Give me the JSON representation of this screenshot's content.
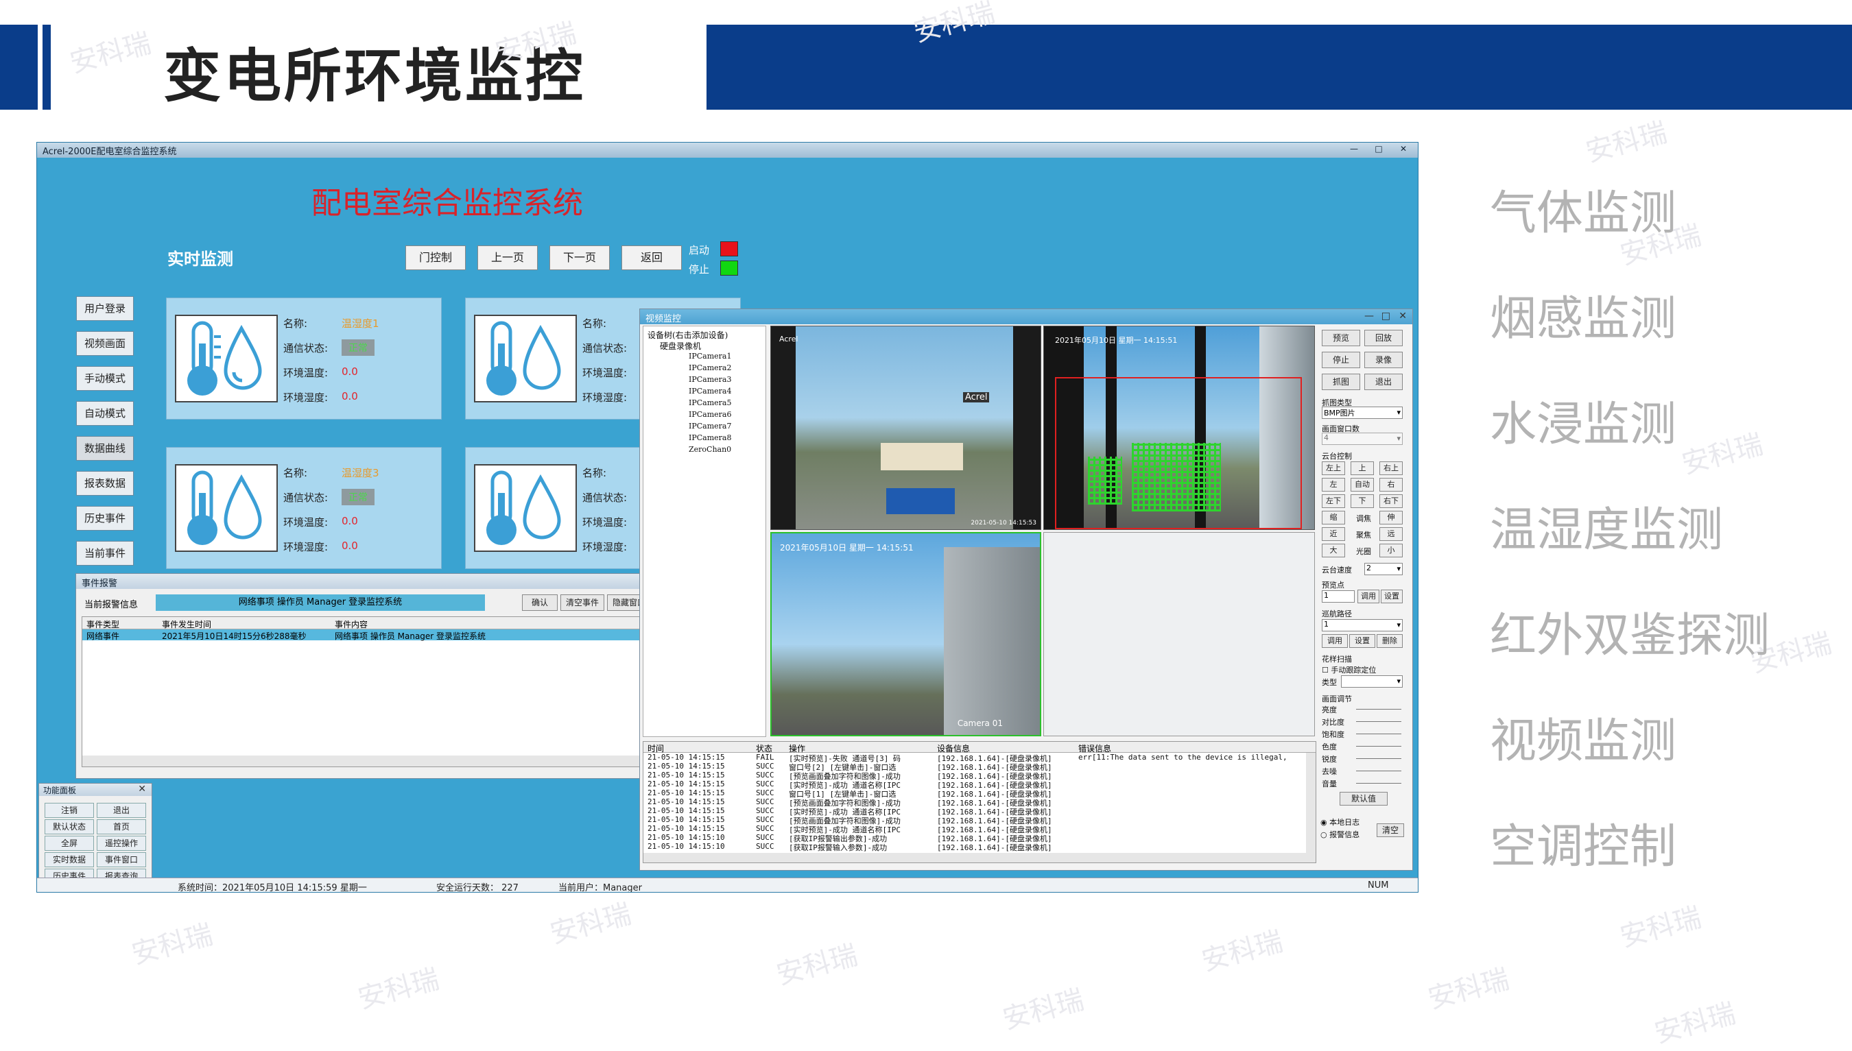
{
  "header": {
    "title": "变电所环境监控",
    "colors": {
      "brand": "#0a3d8a"
    }
  },
  "watermark": "安科瑞",
  "features": [
    "气体监测",
    "烟感监测",
    "水浸监测",
    "温湿度监测",
    "红外双鉴探测",
    "视频监测",
    "空调控制"
  ],
  "app": {
    "window_title": "Acrel-2000E配电室综合监控系统",
    "title": "配电室综合监控系统",
    "realtime_label": "实时监测",
    "toolbar": [
      "门控制",
      "上一页",
      "下一页",
      "返回"
    ],
    "indicators": [
      {
        "label": "启动",
        "color": "#e8121b"
      },
      {
        "label": "停止",
        "color": "#11d711"
      }
    ],
    "nav": [
      "用户登录",
      "视频画面",
      "手动模式",
      "自动模式",
      "数据曲线",
      "报表数据",
      "历史事件",
      "当前事件"
    ],
    "field_labels": {
      "name": "名称:",
      "status": "通信状态:",
      "temp": "环境温度:",
      "humid": "环境湿度:"
    },
    "sensors": [
      {
        "name": "温湿度1",
        "status": "正常",
        "temp": "0.0",
        "humid": "0.0"
      },
      {
        "name": "",
        "status": "",
        "temp": "",
        "humid": ""
      },
      {
        "name": "温湿度3",
        "status": "正常",
        "temp": "0.0",
        "humid": "0.0"
      },
      {
        "name": "",
        "status": "",
        "temp": "",
        "humid": ""
      }
    ],
    "event_panel": {
      "title": "事件报警",
      "current_label": "当前报警信息",
      "current_text": "网络事项 操作员 Manager 登录监控系统",
      "buttons": [
        "确认",
        "清空事件",
        "隐藏窗口"
      ],
      "columns": [
        "事件类型",
        "事件发生时间",
        "事件内容"
      ],
      "rows": [
        [
          "网络事件",
          "2021年5月10日14时15分6秒288毫秒",
          "网络事项 操作员 Manager 登录监控系统"
        ]
      ]
    },
    "func_panel": {
      "title": "功能面板",
      "buttons": [
        "注销",
        "退出",
        "默认状态",
        "首页",
        "全屏",
        "遥控操作",
        "实时数据",
        "事件窗口",
        "历史事件",
        "报表查询"
      ]
    },
    "status_bar": {
      "time": "系统时间：2021年05月10日  14:15:59   星期一",
      "safe_days": "安全运行天数：  227",
      "user": "当前用户：Manager",
      "num": "NUM"
    },
    "video": {
      "title": "视频监控",
      "tree": [
        "设备树(右击添加设备)",
        "硬盘录像机",
        "IPCamera1",
        "IPCamera2",
        "IPCamera3",
        "IPCamera4",
        "IPCamera5",
        "IPCamera6",
        "IPCamera7",
        "IPCamera8",
        "ZeroChan0"
      ],
      "cam_labels": [
        "",
        "2021年05月10日  星期一  14:15:51",
        "2021年05月10日  星期一  14:15:51",
        ""
      ],
      "cam_brand": "Acrel",
      "cam_time": "2021-05-10 14:15:53",
      "cam_name": "Camera 01",
      "side_buttons": [
        "预览",
        "回放",
        "停止",
        "录像",
        "抓图",
        "退出"
      ],
      "capture_type_label": "抓图类型",
      "capture_type": "BMP图片",
      "window_count_label": "画面窗口数",
      "window_count": "4",
      "ptz_label": "云台控制",
      "ptz": [
        "左上",
        "上",
        "右上",
        "左",
        "自动",
        "右",
        "左下",
        "下",
        "右下",
        "缩",
        "调焦",
        "伸",
        "近",
        "聚焦",
        "远",
        "大",
        "光圈",
        "小"
      ],
      "ptz_speed_label": "云台速度",
      "ptz_speed": "2",
      "preset_label": "预览点",
      "preset": "1",
      "preset_btns": [
        "调用",
        "设置"
      ],
      "cruise_label": "巡航路径",
      "cruise": "1",
      "cruise_btns": [
        "调用",
        "设置",
        "删除"
      ],
      "pattern_label": "花样扫描",
      "manual_track": "手动跟踪定位",
      "type_label": "类型",
      "image_label": "画面调节",
      "image_params": [
        "亮度",
        "对比度",
        "饱和度",
        "色度",
        "锐度",
        "去噪",
        "音量"
      ],
      "default_btn": "默认值",
      "log_columns": [
        "时间",
        "状态",
        "操作",
        "设备信息",
        "错误信息"
      ],
      "log_rows": [
        [
          "21-05-10 14:15:15",
          "FAIL",
          "[实时预览]-失败 通道号[3] 码",
          "[192.168.1.64]-[硬盘录像机]",
          "err[11:The data sent to the device is illegal,"
        ],
        [
          "21-05-10 14:15:15",
          "SUCC",
          "窗口号[2] [左键单击]-窗口选",
          "[192.168.1.64]-[硬盘录像机]",
          ""
        ],
        [
          "21-05-10 14:15:15",
          "SUCC",
          "[预览画面叠加字符和图像]-成功",
          "[192.168.1.64]-[硬盘录像机]",
          ""
        ],
        [
          "21-05-10 14:15:15",
          "SUCC",
          "[实时预览]-成功 通道名称[IPC",
          "[192.168.1.64]-[硬盘录像机]",
          ""
        ],
        [
          "21-05-10 14:15:15",
          "SUCC",
          "窗口号[1] [左键单击]-窗口选",
          "[192.168.1.64]-[硬盘录像机]",
          ""
        ],
        [
          "21-05-10 14:15:15",
          "SUCC",
          "[预览画面叠加字符和图像]-成功",
          "[192.168.1.64]-[硬盘录像机]",
          ""
        ],
        [
          "21-05-10 14:15:15",
          "SUCC",
          "[实时预览]-成功 通道名称[IPC",
          "[192.168.1.64]-[硬盘录像机]",
          ""
        ],
        [
          "21-05-10 14:15:15",
          "SUCC",
          "[预览画面叠加字符和图像]-成功",
          "[192.168.1.64]-[硬盘录像机]",
          ""
        ],
        [
          "21-05-10 14:15:15",
          "SUCC",
          "[实时预览]-成功 通道名称[IPC",
          "[192.168.1.64]-[硬盘录像机]",
          ""
        ],
        [
          "21-05-10 14:15:10",
          "SUCC",
          "[获取IP报警输出参数]-成功",
          "[192.168.1.64]-[硬盘录像机]",
          ""
        ],
        [
          "21-05-10 14:15:10",
          "SUCC",
          "[获取IP报警输入参数]-成功",
          "[192.168.1.64]-[硬盘录像机]",
          ""
        ]
      ],
      "log_opts": [
        "本地日志",
        "报警信息"
      ],
      "clear_btn": "清空"
    }
  }
}
